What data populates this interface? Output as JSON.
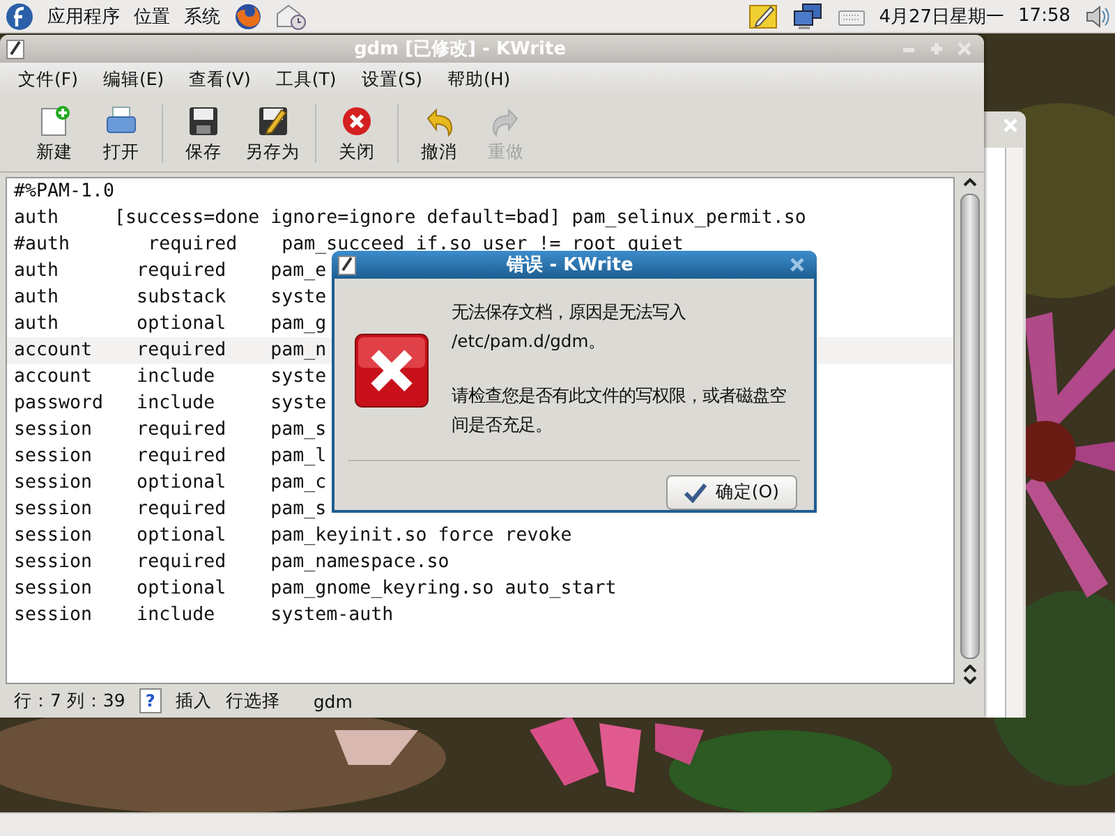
{
  "top_panel": {
    "menus": [
      "应用程序",
      "位置",
      "系统"
    ],
    "date": "4月27日星期一",
    "time": "17:58"
  },
  "window": {
    "title": "gdm [已修改] - KWrite",
    "menu": [
      "文件(F)",
      "编辑(E)",
      "查看(V)",
      "工具(T)",
      "设置(S)",
      "帮助(H)"
    ],
    "toolbar": [
      [
        {
          "label": "新建",
          "kind": "new",
          "disabled": false
        },
        {
          "label": "打开",
          "kind": "open",
          "disabled": false
        }
      ],
      [
        {
          "label": "保存",
          "kind": "save",
          "disabled": false
        },
        {
          "label": "另存为",
          "kind": "saveas",
          "disabled": false
        }
      ],
      [
        {
          "label": "关闭",
          "kind": "close",
          "disabled": false
        }
      ],
      [
        {
          "label": "撤消",
          "kind": "undo",
          "disabled": false
        },
        {
          "label": "重做",
          "kind": "redo",
          "disabled": true
        }
      ]
    ],
    "lines": [
      {
        "text": "#%PAM-1.0",
        "current": false
      },
      {
        "text": "auth     [success=done ignore=ignore default=bad] pam_selinux_permit.so",
        "current": false
      },
      {
        "text": "#auth       required    pam_succeed if.so user != root quiet",
        "current": false
      },
      {
        "text": "auth       required    pam_e",
        "current": false
      },
      {
        "text": "auth       substack    syste",
        "current": false
      },
      {
        "text": "auth       optional    pam_g",
        "current": false
      },
      {
        "text": "account    required    pam_n",
        "current": true
      },
      {
        "text": "account    include     syste",
        "current": false
      },
      {
        "text": "password   include     syste",
        "current": false
      },
      {
        "text": "session    required    pam_s",
        "current": false
      },
      {
        "text": "session    required    pam_l",
        "current": false
      },
      {
        "text": "session    optional    pam_c",
        "current": false
      },
      {
        "text": "session    required    pam_s",
        "current": false
      },
      {
        "text": "session    optional    pam_keyinit.so force revoke",
        "current": false
      },
      {
        "text": "session    required    pam_namespace.so",
        "current": false
      },
      {
        "text": "session    optional    pam_gnome_keyring.so auto_start",
        "current": false
      },
      {
        "text": "session    include     system-auth",
        "current": false
      }
    ],
    "status_bar": {
      "position": "行：7 列：39",
      "help": "?",
      "mode": "插入",
      "selection_mode": "行选择",
      "file": "gdm"
    }
  },
  "dialog": {
    "title": "错误 - KWrite",
    "message": [
      {
        "lines": [
          "无法保存文档，原因是无法写入",
          "/etc/pam.d/gdm。"
        ]
      },
      {
        "lines": [
          "请检查您是否有此文件的写权限，或者磁盘空间是否充足。"
        ]
      }
    ],
    "button": "确定(O)"
  }
}
